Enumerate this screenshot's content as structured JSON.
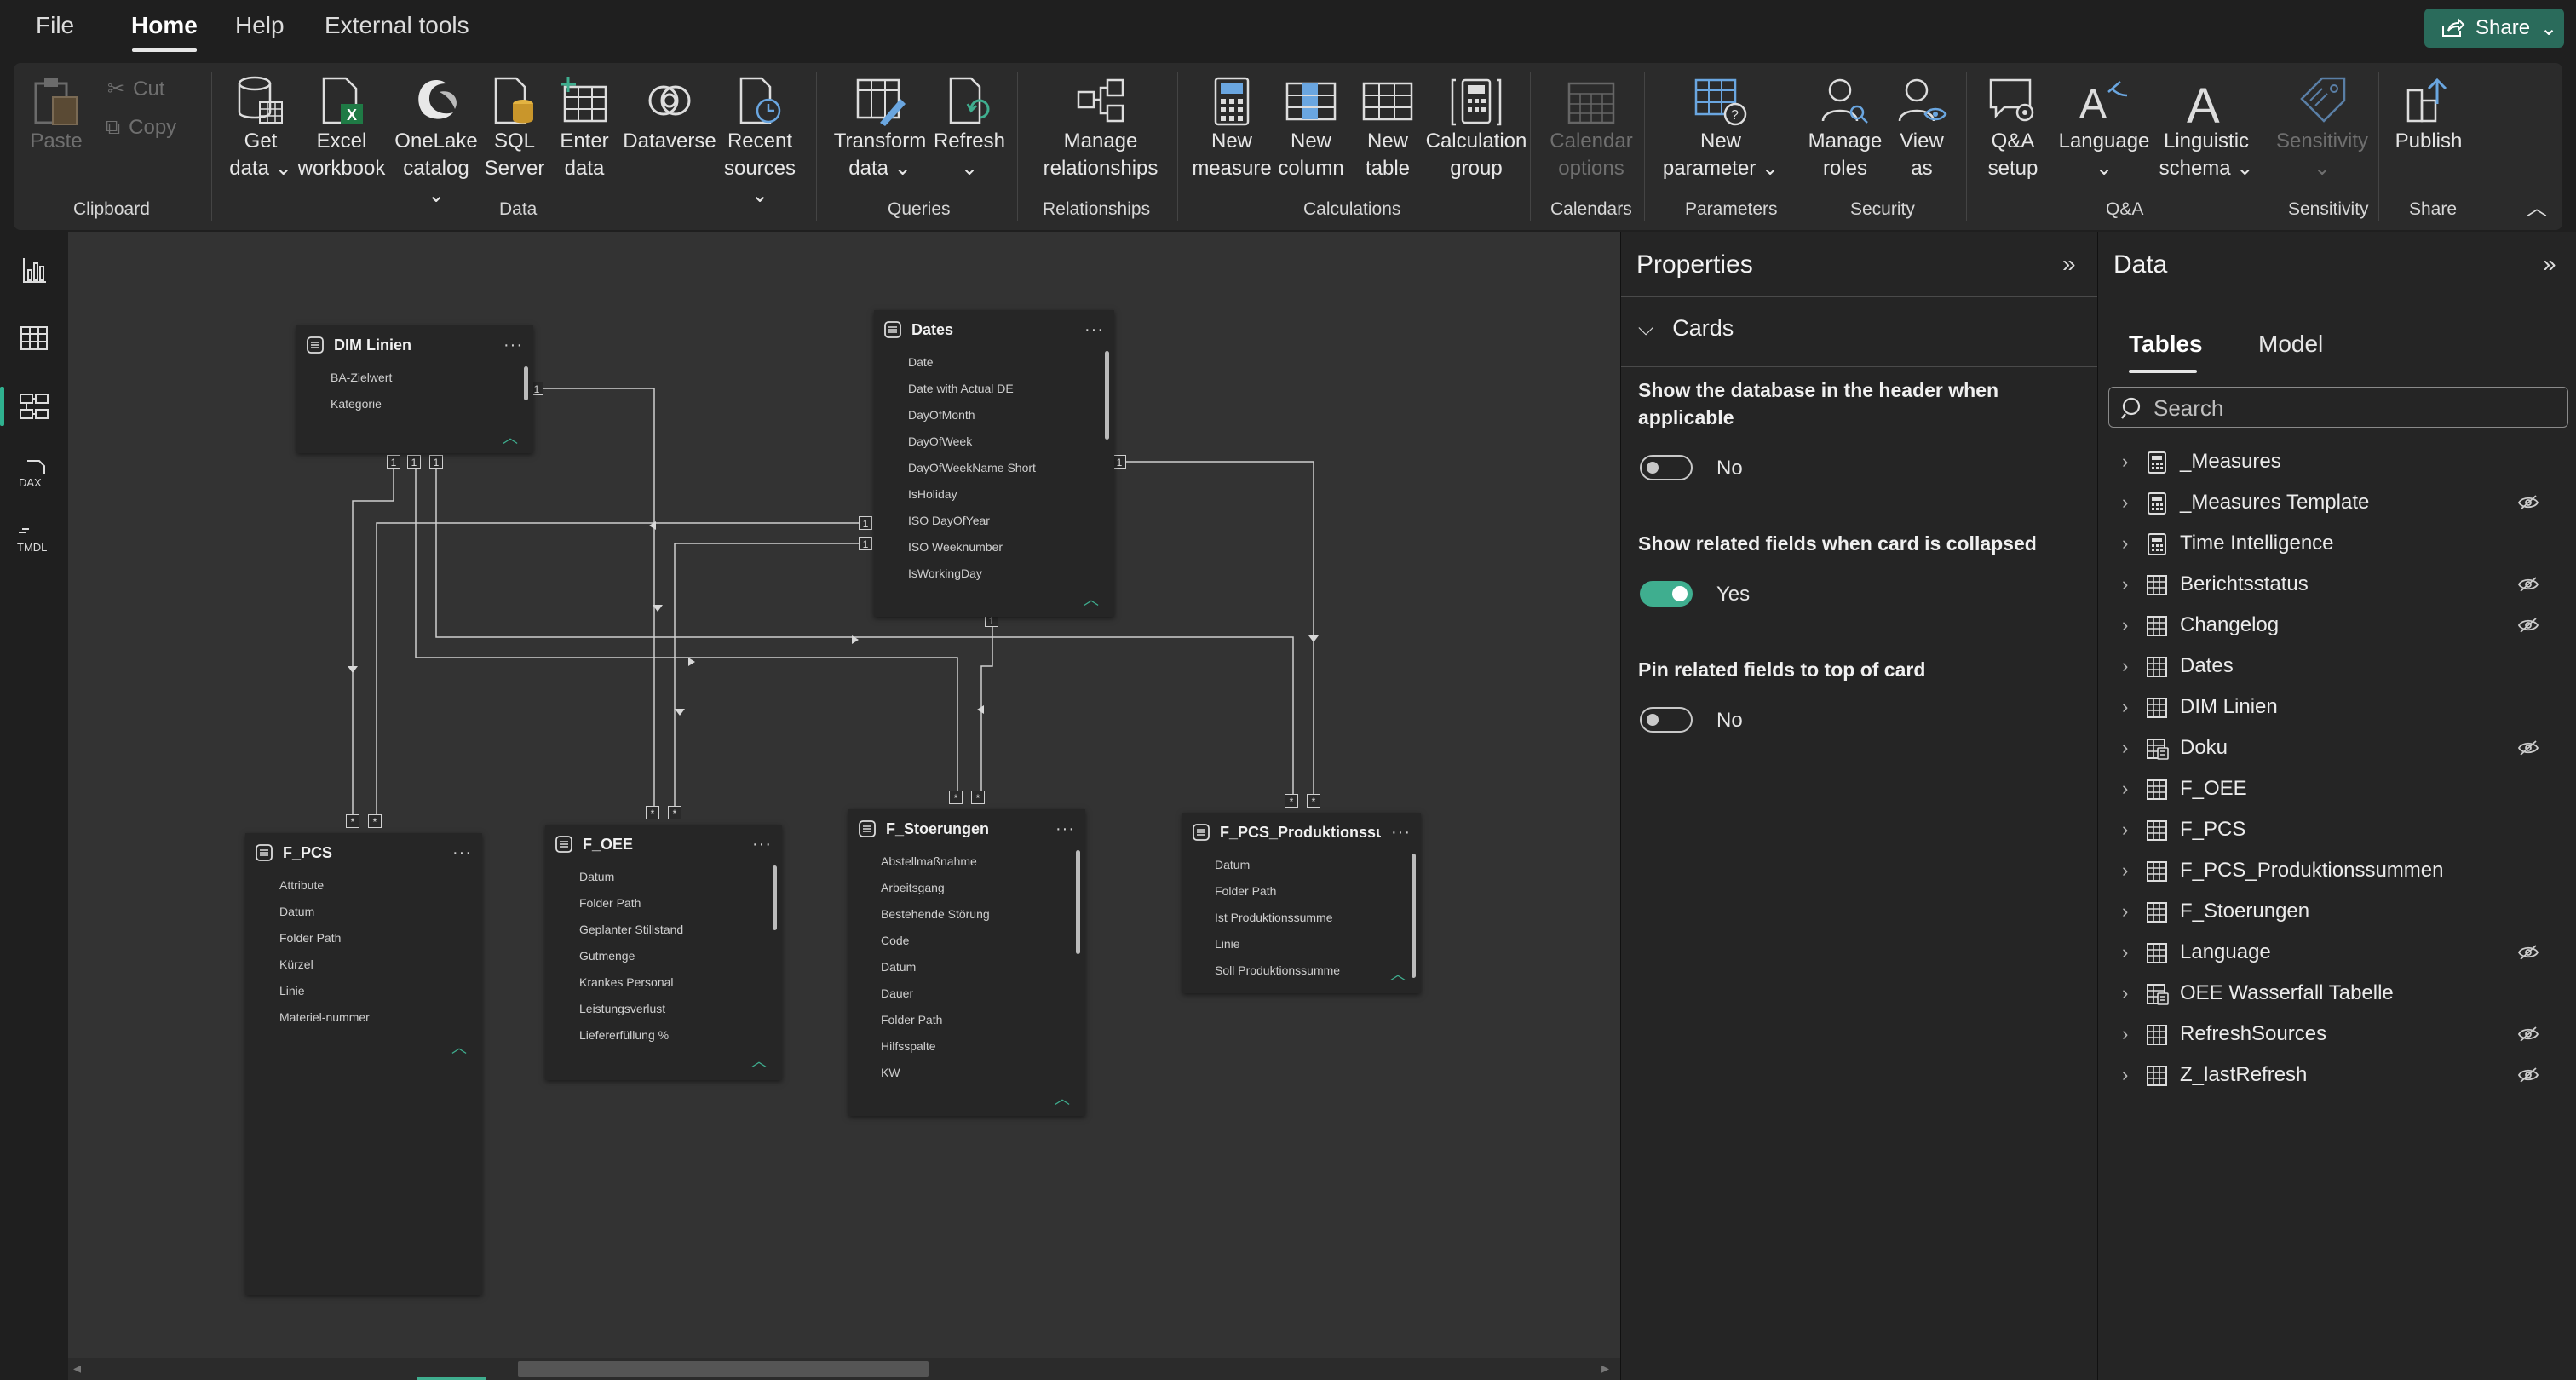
{
  "menu": {
    "file": "File",
    "home": "Home",
    "help": "Help",
    "external_tools": "External tools",
    "share": "Share"
  },
  "ribbon": {
    "clipboard": {
      "paste": "Paste",
      "cut": "Cut",
      "copy": "Copy",
      "group": "Clipboard"
    },
    "data": {
      "get_data": "Get\ndata ⌄",
      "excel": "Excel\nworkbook",
      "onelake": "OneLake\ncatalog ⌄",
      "sql": "SQL\nServer",
      "enter_data": "Enter\ndata",
      "dataverse": "Dataverse",
      "recent": "Recent\nsources ⌄",
      "group": "Data"
    },
    "queries": {
      "transform": "Transform\ndata ⌄",
      "refresh": "Refresh\n⌄",
      "group": "Queries"
    },
    "relationships": {
      "manage": "Manage\nrelationships",
      "group": "Relationships"
    },
    "calculations": {
      "new_measure": "New\nmeasure",
      "new_column": "New\ncolumn",
      "new_table": "New\ntable",
      "calc_group": "Calculation\ngroup",
      "group": "Calculations"
    },
    "calendars": {
      "calendar_options": "Calendar\noptions",
      "group": "Calendars"
    },
    "parameters": {
      "new_parameter": "New\nparameter ⌄",
      "group": "Parameters"
    },
    "security": {
      "manage_roles": "Manage\nroles",
      "view_as": "View\nas",
      "group": "Security"
    },
    "qa": {
      "qa_setup": "Q&A\nsetup",
      "language": "Language\n⌄",
      "linguistic": "Linguistic\nschema ⌄",
      "group": "Q&A"
    },
    "sensitivity": {
      "sensitivity": "Sensitivity\n⌄",
      "group": "Sensitivity"
    },
    "share": {
      "publish": "Publish",
      "group": "Share"
    }
  },
  "leftnav": {
    "dax": "DAX",
    "tmdl": "TMDL"
  },
  "canvas": {
    "cards": [
      {
        "title": "DIM Linien",
        "fields": [
          "BA-Zielwert",
          "Kategorie"
        ]
      },
      {
        "title": "Dates",
        "fields": [
          "Date",
          "Date with Actual DE",
          "DayOfMonth",
          "DayOfWeek",
          "DayOfWeekName Short",
          "IsHoliday",
          "ISO DayOfYear",
          "ISO Weeknumber",
          "IsWorkingDay"
        ]
      },
      {
        "title": "F_PCS",
        "fields": [
          "Attribute",
          "Datum",
          "Folder Path",
          "Kürzel",
          "Linie",
          "Materiel-nummer"
        ]
      },
      {
        "title": "F_OEE",
        "fields": [
          "Datum",
          "Folder Path",
          "Geplanter Stillstand",
          "Gutmenge",
          "Krankes Personal",
          "Leistungsverlust",
          "Liefererfüllung %"
        ]
      },
      {
        "title": "F_Stoerungen",
        "fields": [
          "Abstellmaßnahme",
          "Arbeitsgang",
          "Bestehende Störung",
          "Code",
          "Datum",
          "Dauer",
          "Folder Path",
          "Hilfsspalte",
          "KW"
        ]
      },
      {
        "title": "F_PCS_Produktionssum...",
        "fields": [
          "Datum",
          "Folder Path",
          "Ist Produktionssumme",
          "Linie",
          "Soll Produktionssumme"
        ]
      }
    ],
    "markers": {
      "one": "1",
      "many": "*"
    }
  },
  "properties": {
    "title": "Properties",
    "section": "Cards",
    "settings": [
      {
        "label": "Show the database in the header when applicable",
        "state": "No",
        "on": false
      },
      {
        "label": "Show related fields when card is collapsed",
        "state": "Yes",
        "on": true
      },
      {
        "label": "Pin related fields to top of card",
        "state": "No",
        "on": false
      }
    ]
  },
  "datapane": {
    "title": "Data",
    "tabs": {
      "tables": "Tables",
      "model": "Model"
    },
    "search_placeholder": "Search",
    "tables": [
      {
        "name": "_Measures",
        "icon": "calculator-icon",
        "hidden": false
      },
      {
        "name": "_Measures Template",
        "icon": "calculator-icon",
        "hidden": true
      },
      {
        "name": "Time Intelligence",
        "icon": "calculator-icon",
        "hidden": false
      },
      {
        "name": "Berichtsstatus",
        "icon": "table-icon",
        "hidden": true
      },
      {
        "name": "Changelog",
        "icon": "table-icon",
        "hidden": true
      },
      {
        "name": "Dates",
        "icon": "table-icon",
        "hidden": false
      },
      {
        "name": "DIM Linien",
        "icon": "table-icon",
        "hidden": false
      },
      {
        "name": "Doku",
        "icon": "calculated-table-icon",
        "hidden": true
      },
      {
        "name": "F_OEE",
        "icon": "table-icon",
        "hidden": false
      },
      {
        "name": "F_PCS",
        "icon": "table-icon",
        "hidden": false
      },
      {
        "name": "F_PCS_Produktionssummen",
        "icon": "table-icon",
        "hidden": false
      },
      {
        "name": "F_Stoerungen",
        "icon": "table-icon",
        "hidden": false
      },
      {
        "name": "Language",
        "icon": "table-icon",
        "hidden": true
      },
      {
        "name": "OEE Wasserfall Tabelle",
        "icon": "calculated-table-icon",
        "hidden": false
      },
      {
        "name": "RefreshSources",
        "icon": "table-icon",
        "hidden": true
      },
      {
        "name": "Z_lastRefresh",
        "icon": "table-icon",
        "hidden": true
      }
    ]
  }
}
